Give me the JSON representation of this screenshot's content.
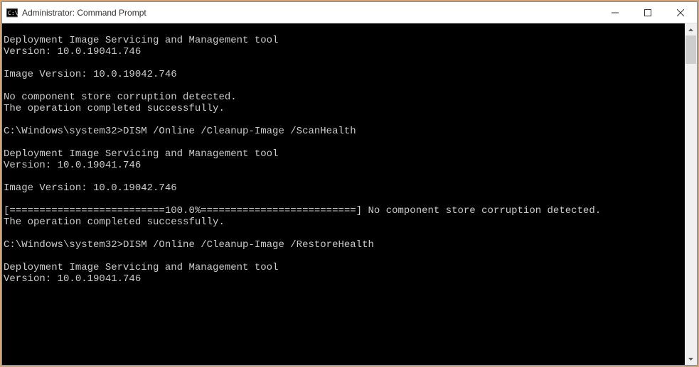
{
  "window": {
    "title": "Administrator: Command Prompt"
  },
  "console": {
    "lines": [
      "",
      "Deployment Image Servicing and Management tool",
      "Version: 10.0.19041.746",
      "",
      "Image Version: 10.0.19042.746",
      "",
      "No component store corruption detected.",
      "The operation completed successfully.",
      "",
      "C:\\Windows\\system32>DISM /Online /Cleanup-Image /ScanHealth",
      "",
      "Deployment Image Servicing and Management tool",
      "Version: 10.0.19041.746",
      "",
      "Image Version: 10.0.19042.746",
      "",
      "[==========================100.0%==========================] No component store corruption detected.",
      "The operation completed successfully.",
      "",
      "C:\\Windows\\system32>DISM /Online /Cleanup-Image /RestoreHealth",
      "",
      "Deployment Image Servicing and Management tool",
      "Version: 10.0.19041.746"
    ]
  }
}
